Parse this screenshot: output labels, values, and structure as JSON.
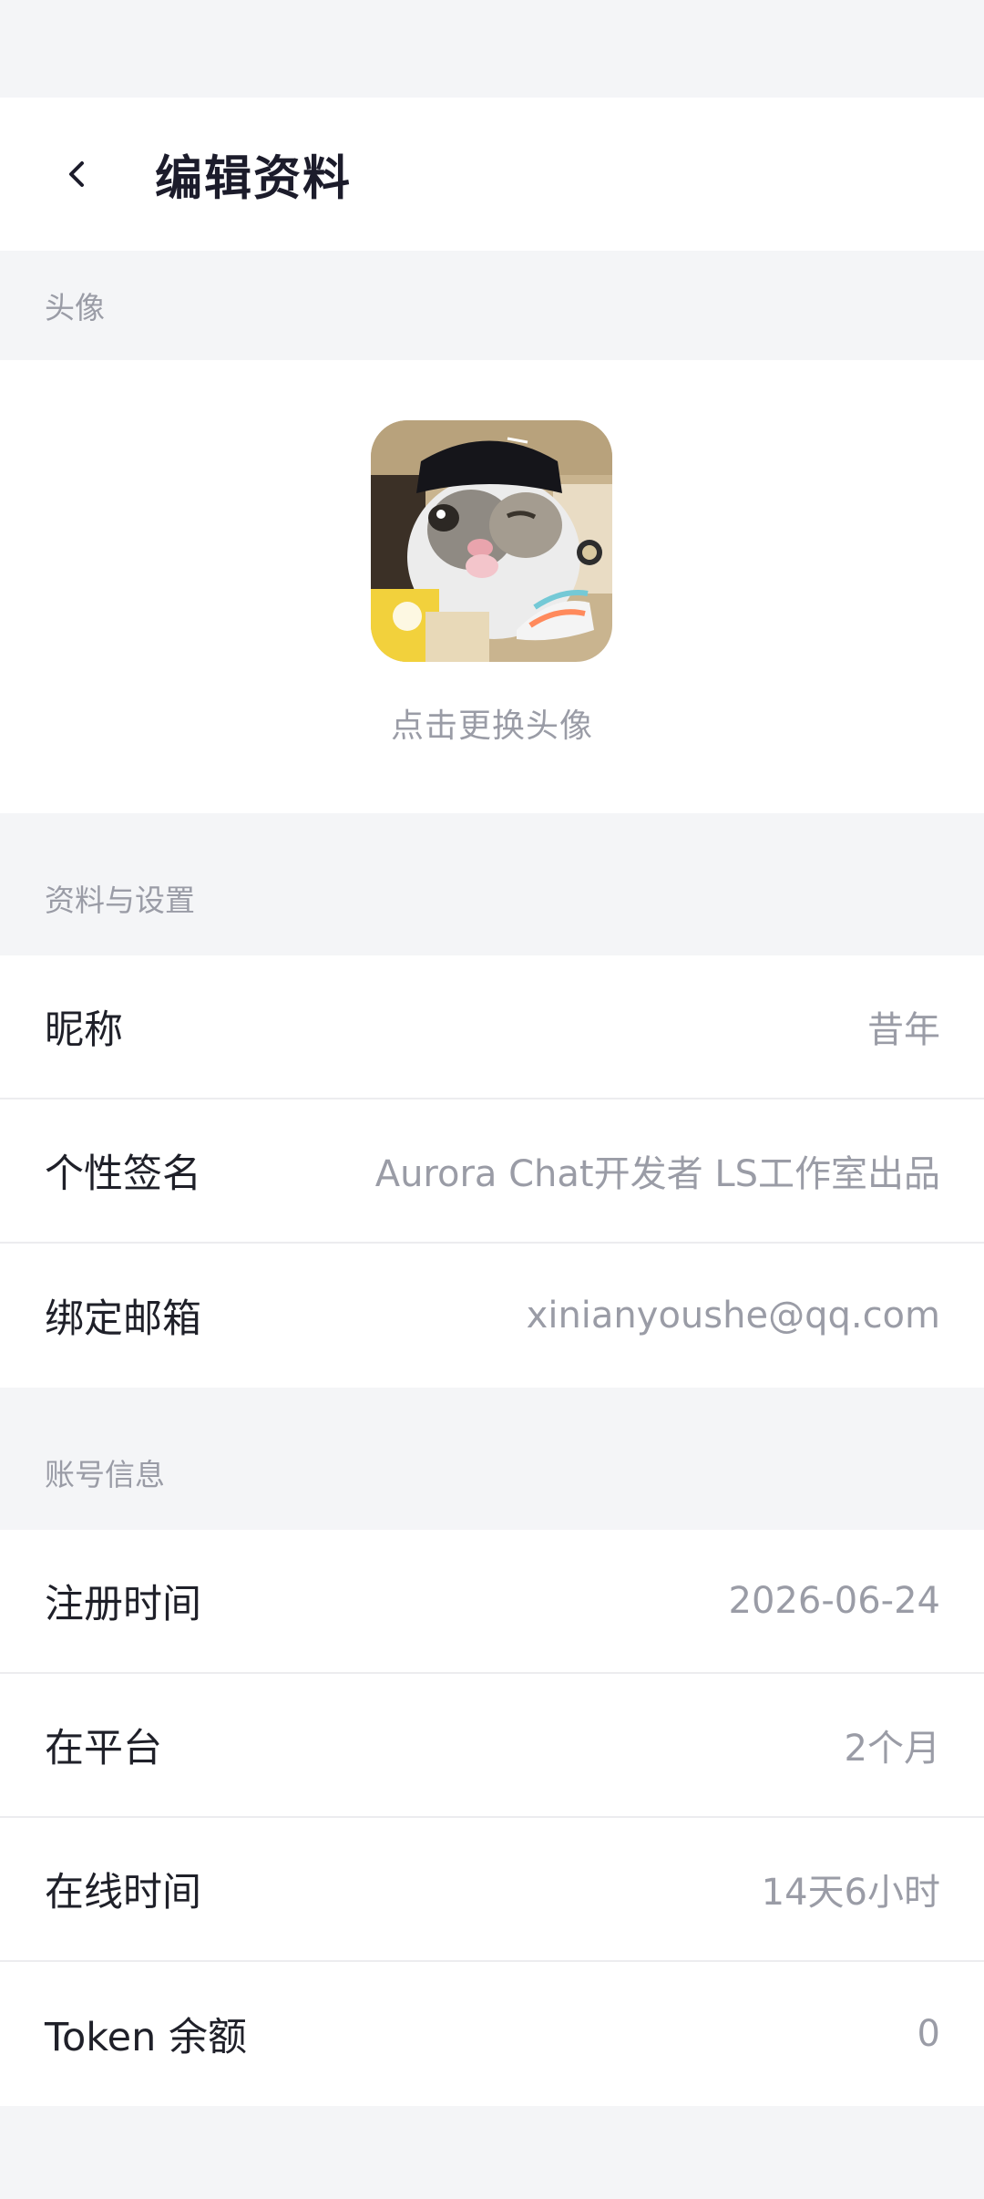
{
  "header": {
    "title": "编辑资料",
    "back_icon": "chevron-left-icon"
  },
  "avatar_section": {
    "label": "头像",
    "hint": "点击更换头像"
  },
  "profile_section": {
    "label": "资料与设置",
    "rows": [
      {
        "label": "昵称",
        "value": "昔年"
      },
      {
        "label": "个性签名",
        "value": "Aurora Chat开发者 LS工作室出品"
      },
      {
        "label": "绑定邮箱",
        "value": "xinianyoushe@qq.com"
      }
    ]
  },
  "account_section": {
    "label": "账号信息",
    "rows": [
      {
        "label": "注册时间",
        "value": "2026-06-24"
      },
      {
        "label": "在平台",
        "value": "2个月"
      },
      {
        "label": "在线时间",
        "value": "14天6小时"
      },
      {
        "label": "Token 余额",
        "value": "0"
      }
    ]
  },
  "colors": {
    "background": "#f4f5f7",
    "card": "#ffffff",
    "title": "#1c1c2b",
    "muted": "#9a9ca6"
  }
}
